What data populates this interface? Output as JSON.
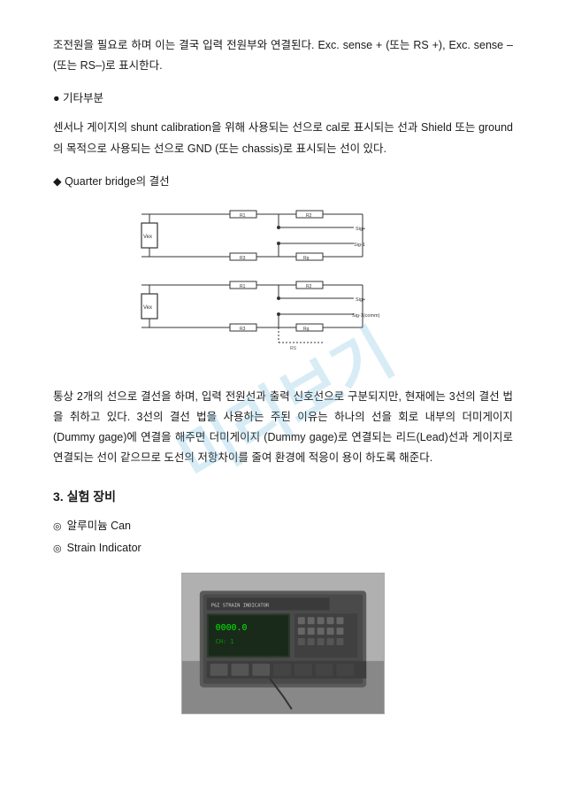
{
  "watermark": {
    "text": "미리보기"
  },
  "intro_paragraph_1": "조전원을 필요로 하며 이는 결국 입력 전원부와 연결된다. Exc. sense + (또는 RS +), Exc. sense – (또는 RS–)로 표시한다.",
  "bullet_other_section": "● 기타부분",
  "paragraph_other": "센서나 게이지의 shunt calibration을 위해 사용되는 선으로 cal로 표시되는 선과 Shield 또는 ground의 목적으로 사용되는 선으로 GND (또는 chassis)로 표시되는 선이 있다.",
  "diamond_header": "◆ Quarter bridge의 결선",
  "main_paragraph": "통상 2개의 선으로 결선을 하며, 입력 전원선과 출력 신호선으로 구분되지만, 현재에는 3선의 결선 법을 취하고 있다. 3선의 결선 법을 사용하는 주된 이유는 하나의 선을 회로 내부의 더미게이지 (Dummy gage)에 연결을 해주면 더미게이지 (Dummy gage)로 연결되는 리드(Lead)선과 게이지로 연결되는 선이 같으므로 도선의 저항차이를 줄여 환경에 적응이 용이 하도록 해준다.",
  "section3_heading": "3. 실험 장비",
  "equipment": {
    "item1": "알루미늄 Can",
    "item2": "Strain Indicator"
  },
  "photo_alt": "Strain Indicator device photo"
}
